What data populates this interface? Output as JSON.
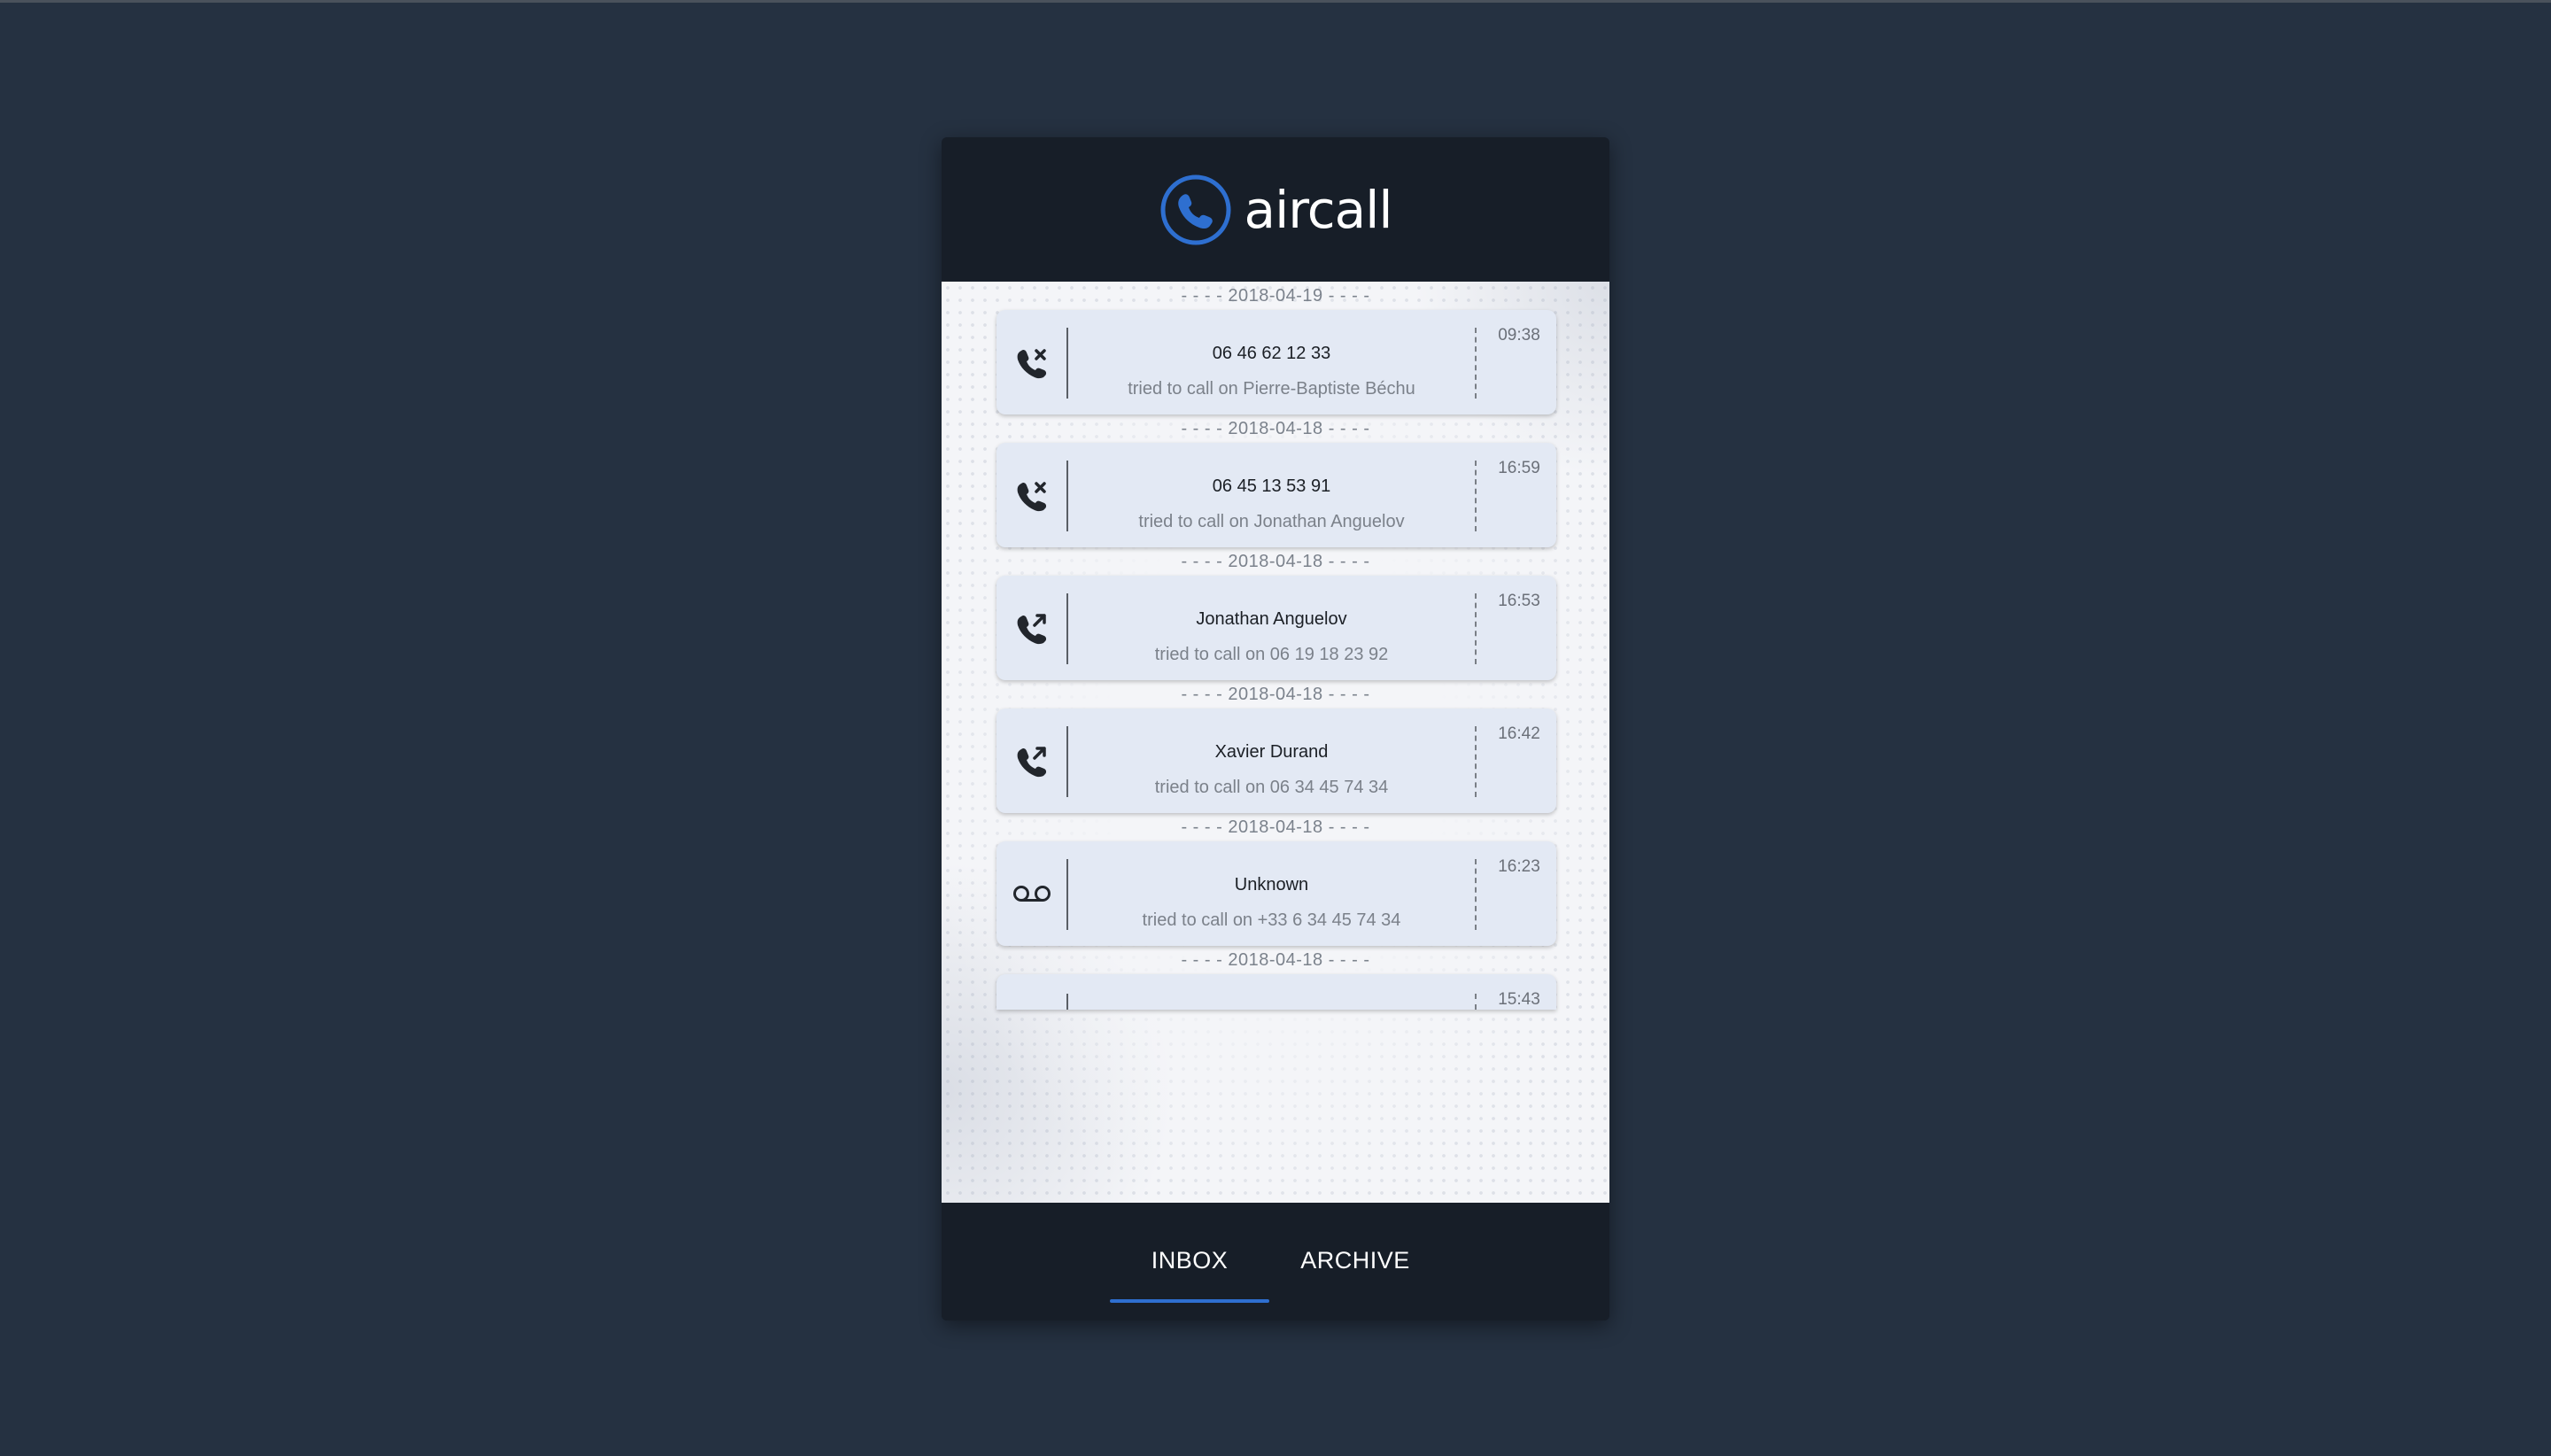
{
  "app": {
    "name": "aircall",
    "brand_color": "#2e6fd0"
  },
  "calls": [
    {
      "date": "- - - - 2018-04-19 - - - -",
      "icon": "missed-call-icon",
      "title": "06 46 62 12 33",
      "subtitle": "tried to call on Pierre-Baptiste Béchu",
      "time": "09:38"
    },
    {
      "date": "- - - - 2018-04-18 - - - -",
      "icon": "missed-call-icon",
      "title": "06 45 13 53 91",
      "subtitle": "tried to call on Jonathan Anguelov",
      "time": "16:59"
    },
    {
      "date": "- - - - 2018-04-18 - - - -",
      "icon": "outgoing-call-icon",
      "title": "Jonathan Anguelov",
      "subtitle": "tried to call on 06 19 18 23 92",
      "time": "16:53"
    },
    {
      "date": "- - - - 2018-04-18 - - - -",
      "icon": "outgoing-call-icon",
      "title": "Xavier Durand",
      "subtitle": "tried to call on 06 34 45 74 34",
      "time": "16:42"
    },
    {
      "date": "- - - - 2018-04-18 - - - -",
      "icon": "voicemail-icon",
      "title": "Unknown",
      "subtitle": "tried to call on +33 6 34 45 74 34",
      "time": "16:23"
    },
    {
      "date": "- - - - 2018-04-18 - - - -",
      "icon": "",
      "title": "",
      "subtitle": "",
      "time": "15:43"
    }
  ],
  "tabs": {
    "inbox": "INBOX",
    "archive": "ARCHIVE",
    "active": "inbox"
  }
}
